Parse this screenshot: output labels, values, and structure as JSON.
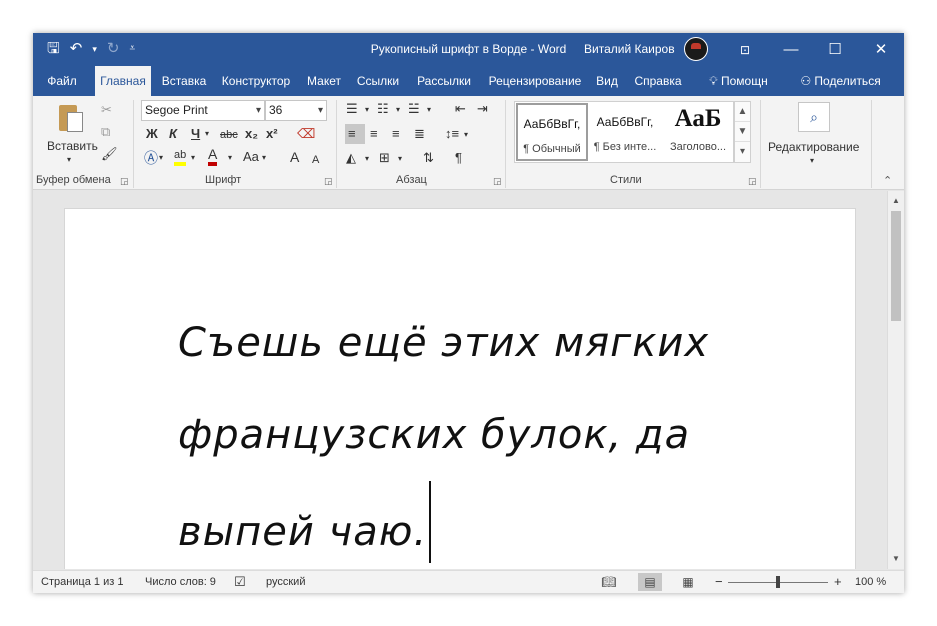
{
  "window": {
    "title": "Рукописный шрифт в Ворде",
    "app_name": "Word",
    "user_name": "Виталий Каиров",
    "accent_color": "#2b579a"
  },
  "qat": {
    "save_icon": "save-icon",
    "undo_icon": "undo-icon",
    "redo_icon": "redo-icon",
    "customize_icon": "customize-qat-icon"
  },
  "tabs": [
    {
      "label": "Файл"
    },
    {
      "label": "Главная"
    },
    {
      "label": "Вставка"
    },
    {
      "label": "Конструктор"
    },
    {
      "label": "Макет"
    },
    {
      "label": "Ссылки"
    },
    {
      "label": "Рассылки"
    },
    {
      "label": "Рецензирование"
    },
    {
      "label": "Вид"
    },
    {
      "label": "Справка"
    },
    {
      "label": "Помощн"
    },
    {
      "label": "Поделиться"
    }
  ],
  "ribbon": {
    "clipboard": {
      "label": "Буфер обмена",
      "paste_label": "Вставить"
    },
    "font": {
      "label": "Шрифт",
      "font_name": "Segoe Print",
      "font_size": "36",
      "bold": "Ж",
      "italic": "К",
      "underline": "Ч",
      "strike": "abc",
      "subscript": "x₂",
      "superscript": "x²",
      "change_case": "Aa",
      "grow": "A",
      "shrink": "A"
    },
    "paragraph": {
      "label": "Абзац"
    },
    "styles": {
      "label": "Стили",
      "items": [
        {
          "sample": "АаБбВвГг,",
          "name": "¶ Обычный"
        },
        {
          "sample": "АаБбВвГг,",
          "name": "¶ Без инте..."
        },
        {
          "sample": "АаБ",
          "name": "Заголово..."
        }
      ]
    },
    "editing": {
      "label": "Редактирование"
    }
  },
  "document": {
    "lines": [
      "Съешь ещё этих мягких",
      "французских булок, да",
      "выпей чаю."
    ]
  },
  "statusbar": {
    "page": "Страница 1 из 1",
    "words": "Число слов: 9",
    "language": "русский",
    "zoom_minus": "−",
    "zoom_plus": "+",
    "zoom": "100 %",
    "zoom_level_percent": 100
  }
}
